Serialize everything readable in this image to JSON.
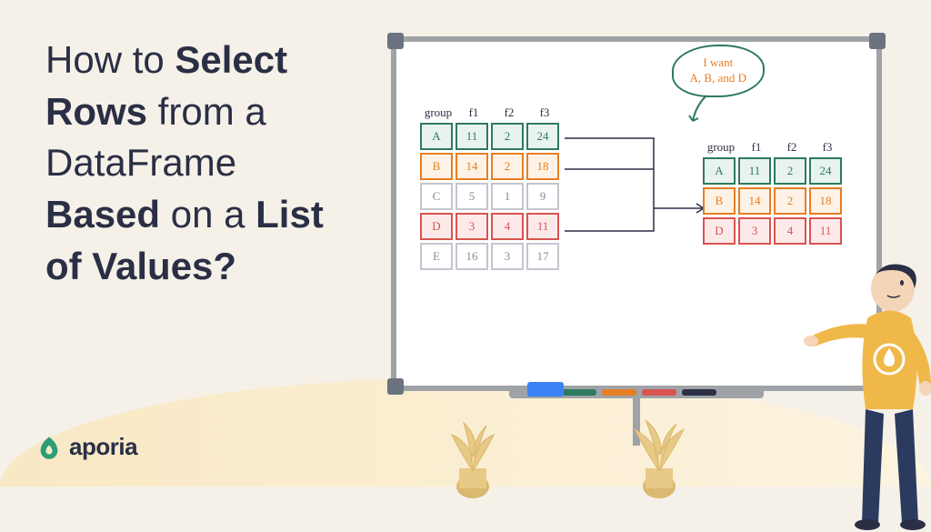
{
  "title_parts": {
    "p1": "How to ",
    "b1": "Select Rows",
    "p2": " from a DataFrame ",
    "b2": "Based",
    "p3": " on a ",
    "b3": "List of Values?"
  },
  "brand": "aporia",
  "bubble": {
    "line1": "I want",
    "line2": "A, B, and D"
  },
  "headers": [
    "group",
    "f1",
    "f2",
    "f3"
  ],
  "source_table": [
    {
      "color": "green",
      "cells": [
        "A",
        "11",
        "2",
        "24"
      ]
    },
    {
      "color": "orange",
      "cells": [
        "B",
        "14",
        "2",
        "18"
      ]
    },
    {
      "color": "gray",
      "cells": [
        "C",
        "5",
        "1",
        "9"
      ]
    },
    {
      "color": "red",
      "cells": [
        "D",
        "3",
        "4",
        "11"
      ]
    },
    {
      "color": "gray",
      "cells": [
        "E",
        "16",
        "3",
        "17"
      ]
    }
  ],
  "result_table": [
    {
      "color": "green",
      "cells": [
        "A",
        "11",
        "2",
        "24"
      ]
    },
    {
      "color": "orange",
      "cells": [
        "B",
        "14",
        "2",
        "18"
      ]
    },
    {
      "color": "red",
      "cells": [
        "D",
        "3",
        "4",
        "11"
      ]
    }
  ],
  "markers": [
    "#2d7a5f",
    "#e67e22",
    "#d9534f",
    "#2a2f45"
  ]
}
